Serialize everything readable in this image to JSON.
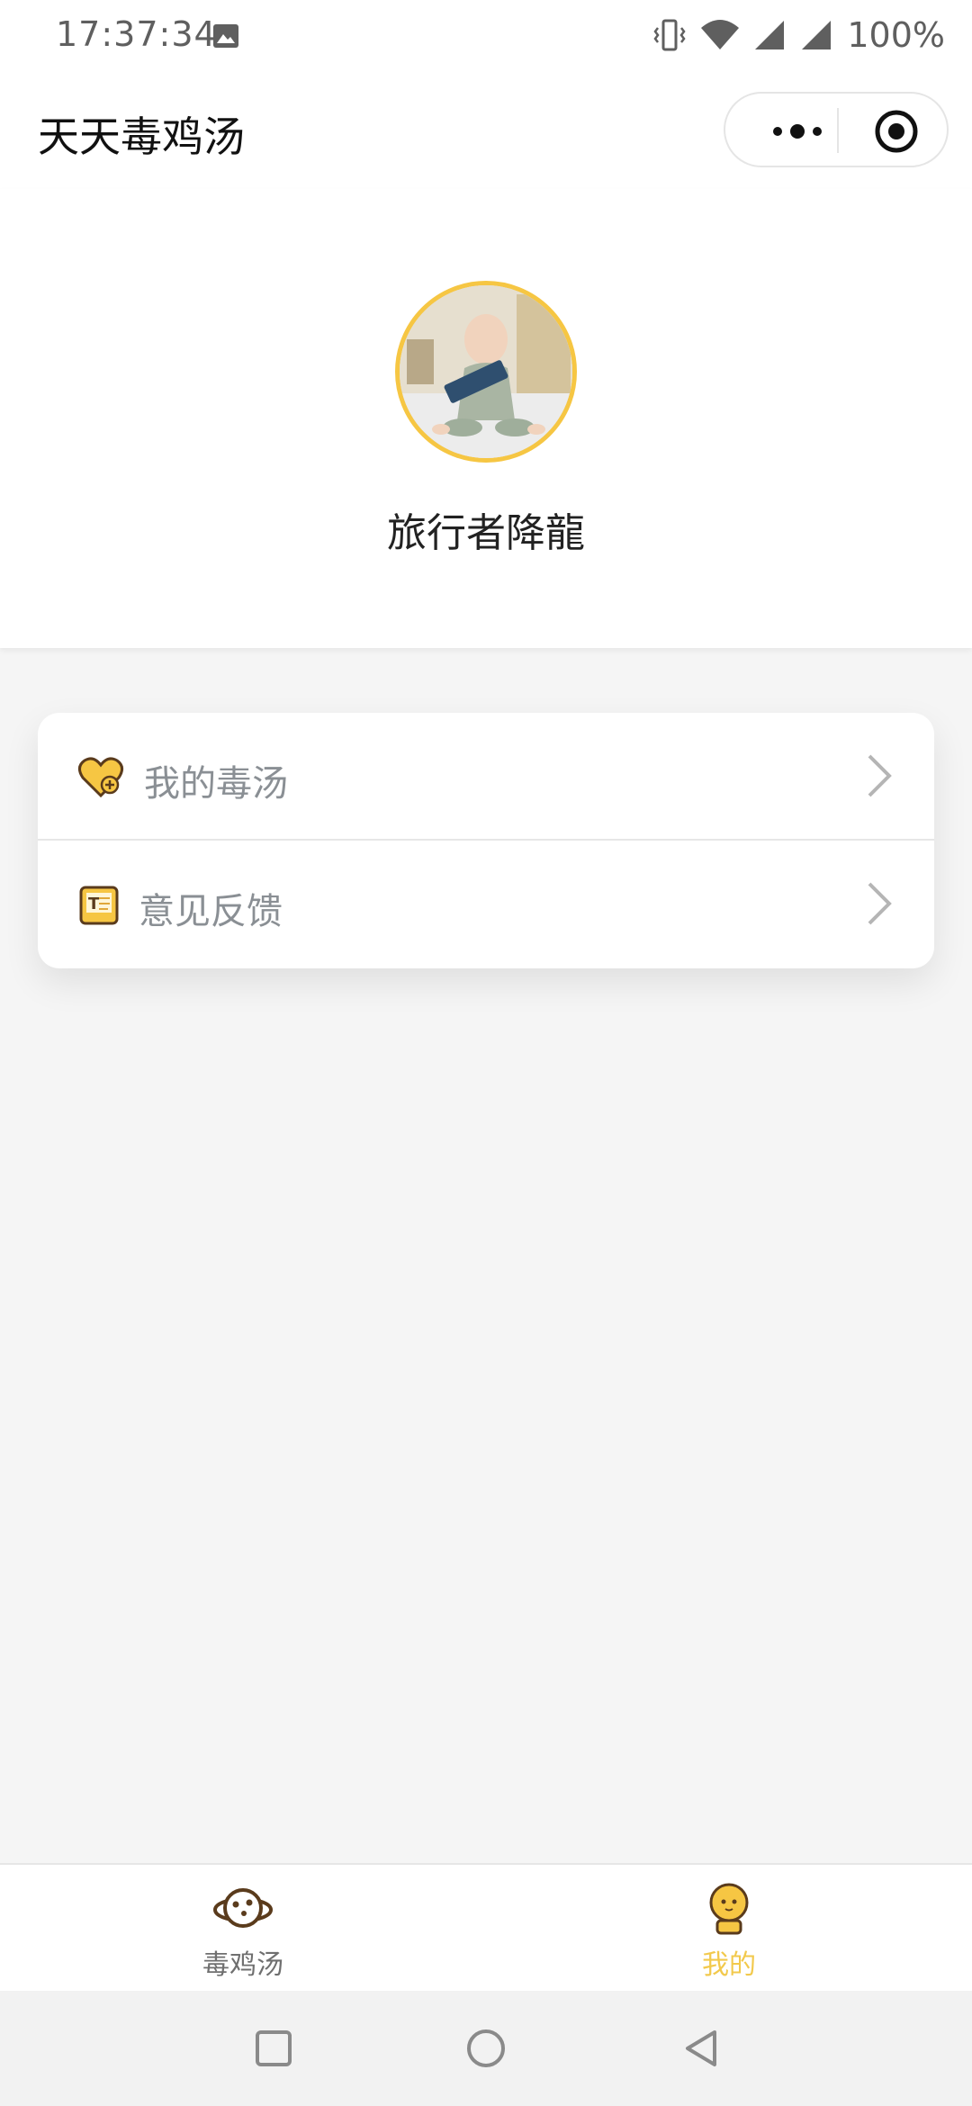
{
  "status_bar": {
    "time": "17:37:34",
    "battery": "100%",
    "icons": [
      "image-icon",
      "vibrate-icon",
      "wifi-icon",
      "signal-icon",
      "signal-icon"
    ]
  },
  "nav": {
    "title": "天天毒鸡汤",
    "icons": [
      "more-icon",
      "target-icon"
    ]
  },
  "profile": {
    "username": "旅行者降龍",
    "avatar_border_color": "#f6c643"
  },
  "menu": {
    "items": [
      {
        "label": "我的毒汤",
        "icon": "heart-plus-icon"
      },
      {
        "label": "意见反馈",
        "icon": "feedback-icon"
      }
    ]
  },
  "tabbar": {
    "tabs": [
      {
        "label": "毒鸡汤",
        "icon": "planet-icon",
        "active": false
      },
      {
        "label": "我的",
        "icon": "astronaut-icon",
        "active": true
      }
    ],
    "active_color": "#f2c94c"
  },
  "system_nav": {
    "icons": [
      "square-icon",
      "circle-icon",
      "back-triangle-icon"
    ]
  }
}
